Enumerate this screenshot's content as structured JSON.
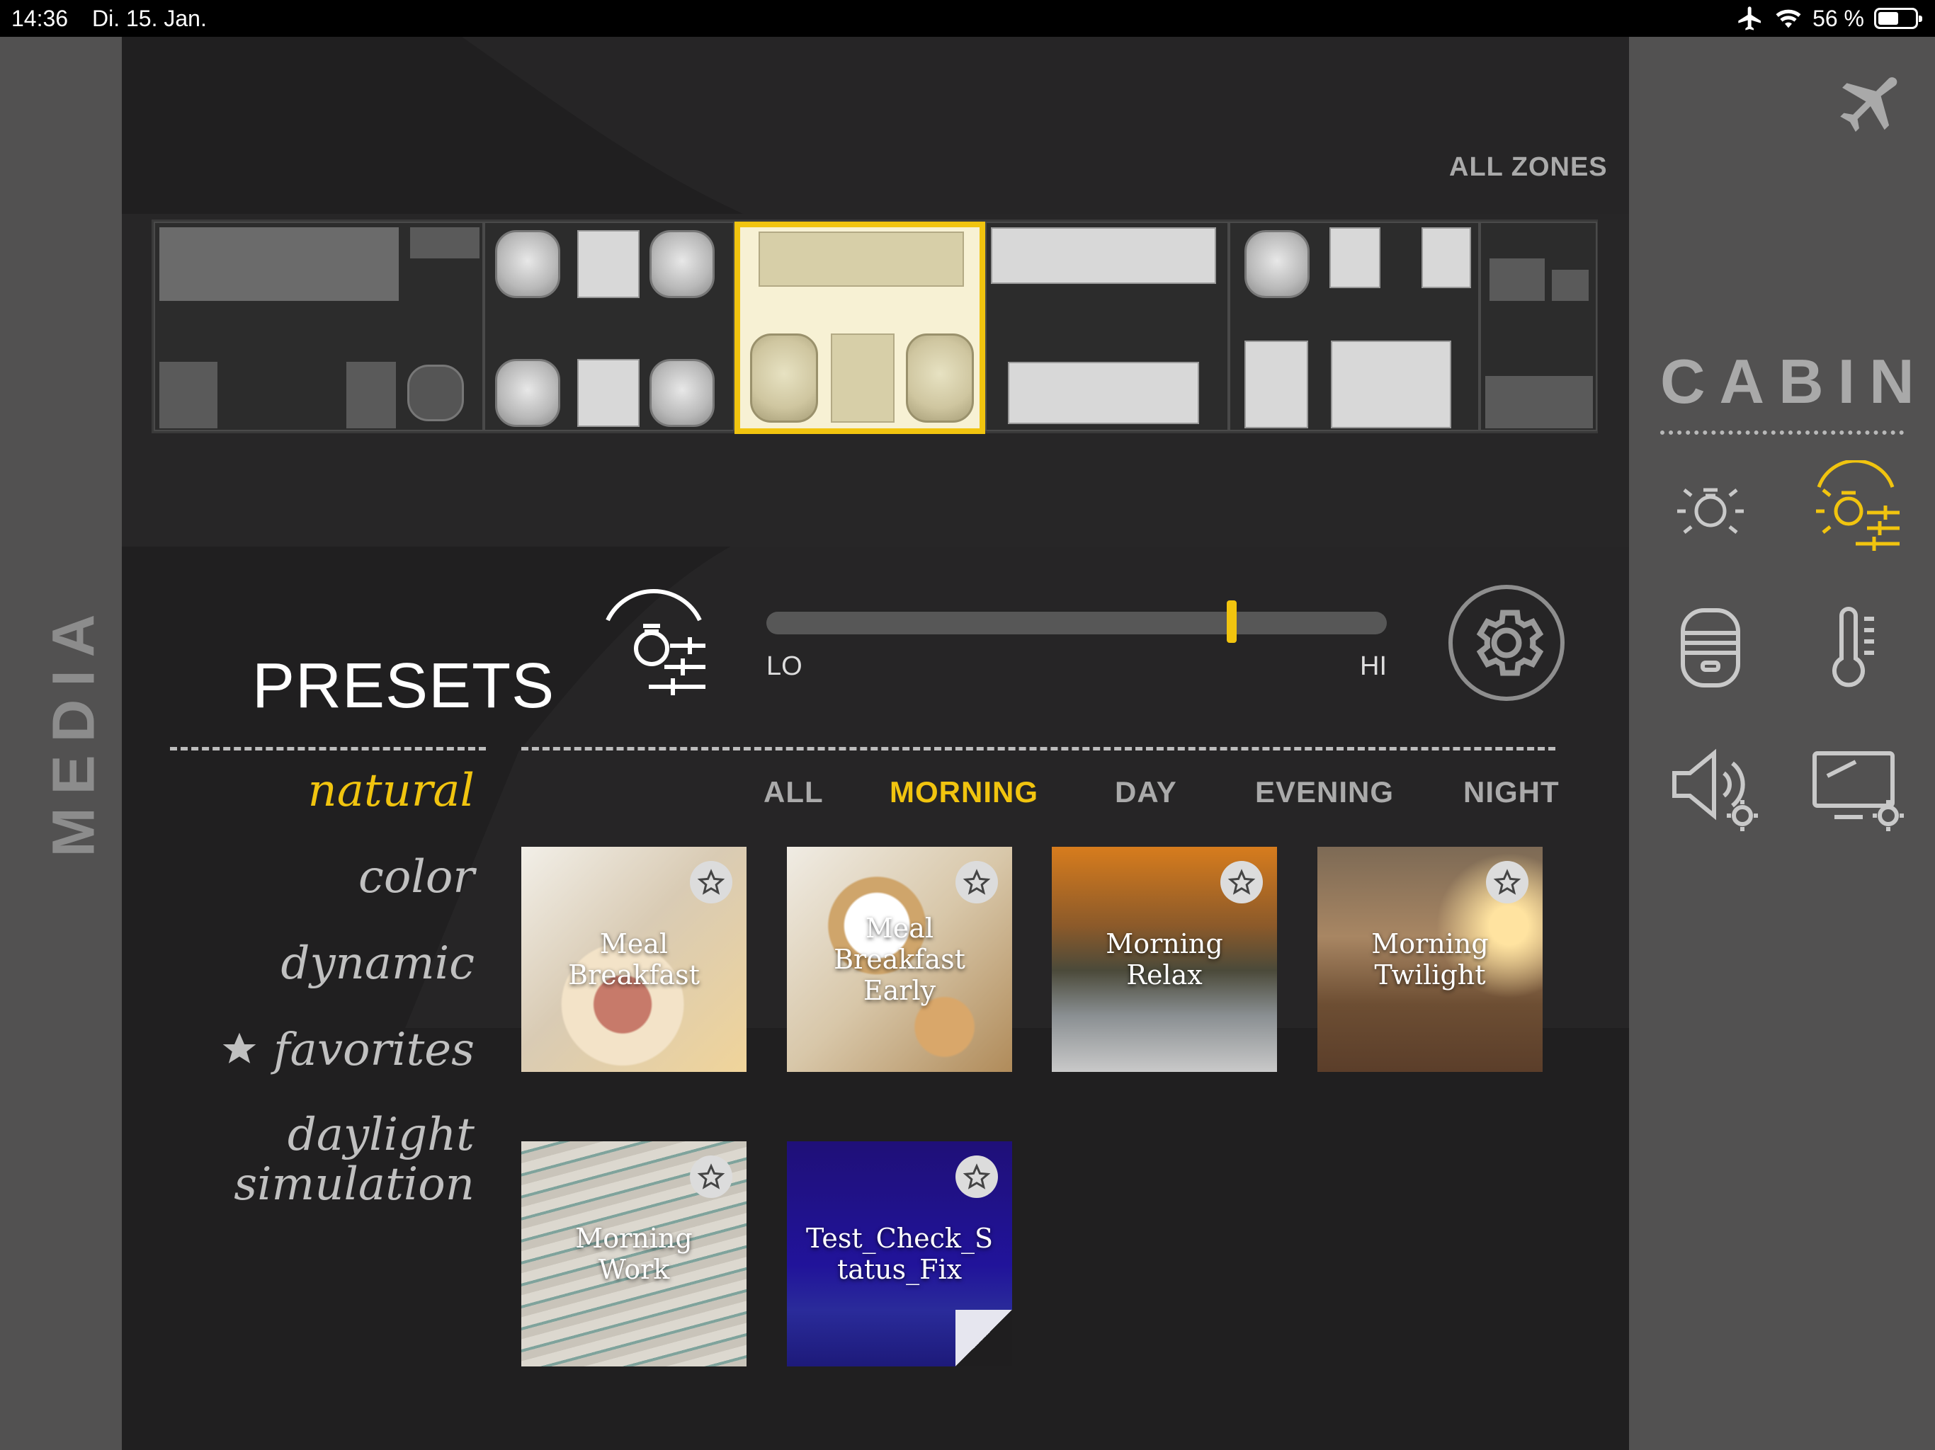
{
  "status_bar": {
    "time": "14:36",
    "date": "Di. 15. Jan.",
    "battery": "56 %",
    "battery_level": 0.56,
    "icons": [
      "airplane-mode-icon",
      "wifi-icon",
      "battery-icon"
    ]
  },
  "media_panel": {
    "label": "MEDIA"
  },
  "cabin_panel": {
    "title": "CABIN",
    "controls": [
      "light-icon",
      "light-presets-icon",
      "window-shade-icon",
      "temperature-icon",
      "sound-settings-icon",
      "display-settings-icon"
    ],
    "active_control": "light-presets-icon",
    "top_icon": "airplane-icon"
  },
  "zones": {
    "all_label": "ALL ZONES",
    "selected_zone": 3
  },
  "presets": {
    "title": "PRESETS",
    "categories": [
      {
        "label": "natural",
        "active": true
      },
      {
        "label": "color",
        "active": false
      },
      {
        "label": "dynamic",
        "active": false
      },
      {
        "label": "favorites",
        "active": false,
        "icon": "star-icon"
      },
      {
        "label": "daylight\nsimulation",
        "active": false
      }
    ],
    "tabs": [
      {
        "label": "ALL",
        "active": false
      },
      {
        "label": "MORNING",
        "active": true
      },
      {
        "label": "DAY",
        "active": false
      },
      {
        "label": "EVENING",
        "active": false
      },
      {
        "label": "NIGHT",
        "active": false
      }
    ],
    "tiles": [
      {
        "label": "Meal\nBreakfast",
        "favorite": false
      },
      {
        "label": "Meal\nBreakfast\nEarly",
        "favorite": false
      },
      {
        "label": "Morning\nRelax",
        "favorite": false
      },
      {
        "label": "Morning\nTwilight",
        "favorite": false
      },
      {
        "label": "Morning\nWork",
        "favorite": false
      },
      {
        "label": "Test_Check_S\ntatus_Fix",
        "favorite": false
      }
    ]
  },
  "dimmer": {
    "lo_label": "LO",
    "hi_label": "HI",
    "level": 0.75
  },
  "colors": {
    "accent": "#f1c40f",
    "panel": "#525151",
    "background": "#201f20"
  }
}
